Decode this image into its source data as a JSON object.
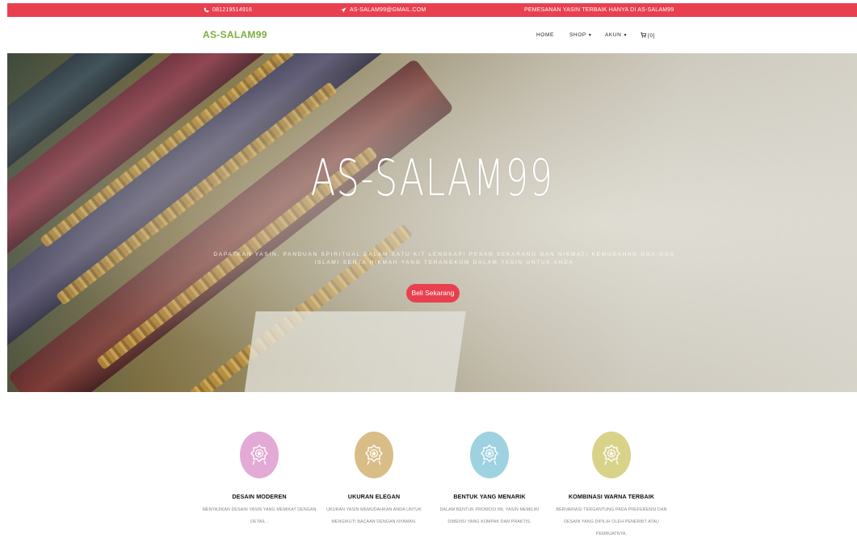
{
  "topbar": {
    "phone": "081219514916",
    "email": "AS-SALAM99@GMAIL.COM",
    "promo": "PEMESANAN YASIN TERBAIK HANYA DI AS-SALAM99",
    "bg_color": "#e8404f",
    "phone_icon": "phone-icon",
    "email_icon": "paper-plane-icon"
  },
  "header": {
    "logo": "AS-SALAM99",
    "logo_color": "#7cae3f",
    "nav": {
      "home": "HOME",
      "shop": "SHOP",
      "akun": "AKUN",
      "cart": "[0]"
    },
    "cart_icon": "cart-icon",
    "dropdown_icon": "caret-down-icon"
  },
  "hero": {
    "title": "AS-SALAM99",
    "subtitle": "DAPATKAN YASIN, PANDUAN SPIRITUAL DALAM SATU KIT LENGKAP! PESAN SEKARANG DAN NIKMATI KEMUDAHAN DOA-DOA ISLAMI SERTA HIKMAH YANG TERANGKUM DALAM YASIN UNTUK ANDA",
    "button": "Beli Sekarang",
    "button_color": "#e8404f"
  },
  "features": [
    {
      "title": "DESAIN MODEREN",
      "description": "MENYAJIKAN DESAIN YASIN YANG MEMIKAT DENGAN DETAIL .",
      "badge_color": "#e2aad4",
      "icon": "badge-emblem-icon"
    },
    {
      "title": "UKURAN ELEGAN",
      "description": "UKURAN YASIN MEMUDAHKAN ANDA UNTUK MENGIKUTI BACAAN DENGAN NYAMAN.",
      "badge_color": "#d9bd86",
      "icon": "badge-emblem-icon"
    },
    {
      "title": "BENTUK YANG MENARIK",
      "description": "DALAM BENTUK PROMOSI INI, YASIN MEMILIKI DIMENSI YANG KOMPAK DAN PRAKTIS.",
      "badge_color": "#9fd2e0",
      "icon": "badge-emblem-icon"
    },
    {
      "title": "KOMBINASI WARNA TERBAIK",
      "description": "BERVARIASI TERGANTUNG PADA PREFERENSI DAN DESAIN YANG DIPILIH OLEH PENERBIT ATAU PEMBUATNYA.",
      "badge_color": "#d9d38a",
      "icon": "badge-emblem-icon"
    }
  ]
}
